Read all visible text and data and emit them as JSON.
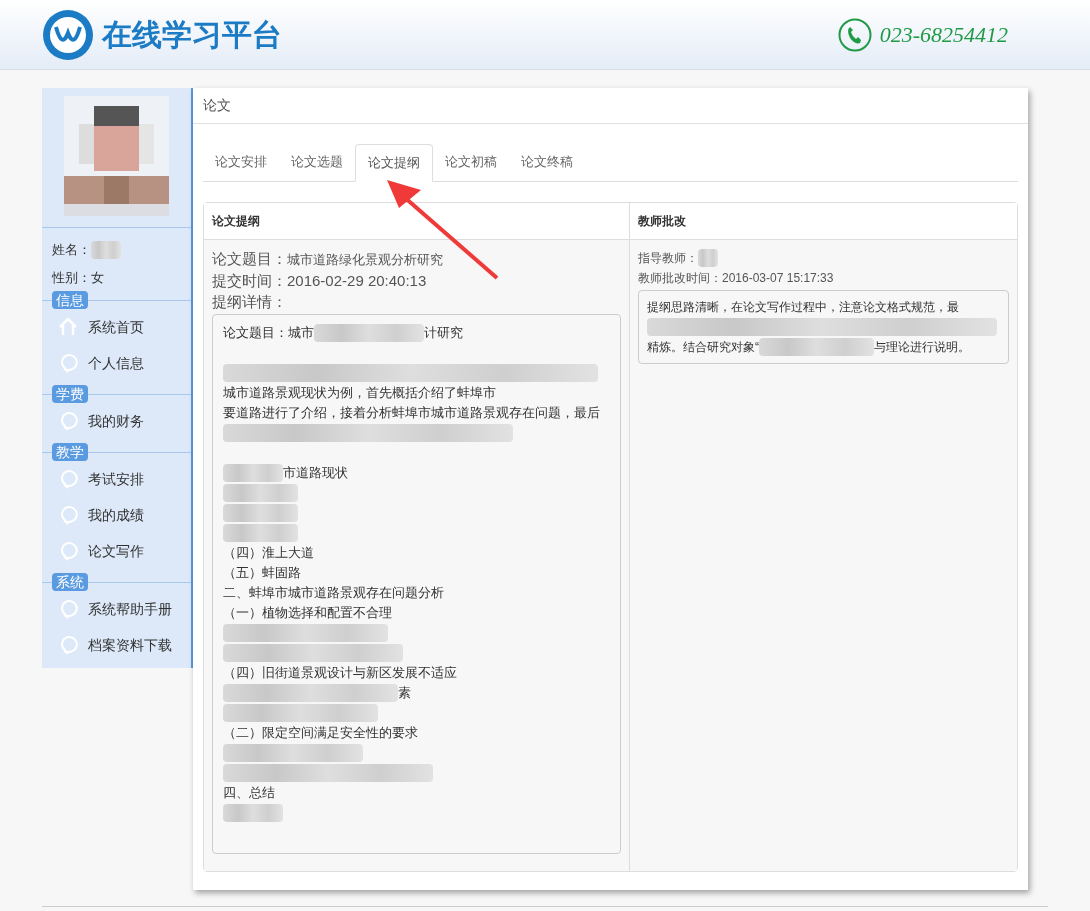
{
  "header": {
    "title": "在线学习平台",
    "phone": "023-68254412"
  },
  "profile": {
    "name_label": "姓名：",
    "gender_label": "性别：",
    "gender": "女"
  },
  "sidebar": [
    {
      "section": "信息",
      "items": [
        {
          "label": "系统首页",
          "kind": "home"
        },
        {
          "label": "个人信息",
          "kind": "bubble"
        }
      ]
    },
    {
      "section": "学费",
      "items": [
        {
          "label": "我的财务",
          "kind": "bubble"
        }
      ]
    },
    {
      "section": "教学",
      "items": [
        {
          "label": "考试安排",
          "kind": "bubble"
        },
        {
          "label": "我的成绩",
          "kind": "bubble"
        },
        {
          "label": "论文写作",
          "kind": "bubble"
        }
      ]
    },
    {
      "section": "系统",
      "items": [
        {
          "label": "系统帮助手册",
          "kind": "bubble"
        },
        {
          "label": "档案资料下载",
          "kind": "bubble"
        }
      ]
    }
  ],
  "panel": {
    "title": "论文",
    "tabs": [
      {
        "label": "论文安排",
        "selected": false
      },
      {
        "label": "论文选题",
        "selected": false
      },
      {
        "label": "论文提纲",
        "selected": true
      },
      {
        "label": "论文初稿",
        "selected": false
      },
      {
        "label": "论文终稿",
        "selected": false
      }
    ],
    "outline": {
      "heading": "论文提纲",
      "topic_label": "论文题目：",
      "topic": "城市道路绿化景观分析研究",
      "time_label": "提交时间：",
      "time": "2016-02-29 20:40:13",
      "details_label": "提纲详情：",
      "lines": [
        [
          {
            "kind": "text",
            "text": "论文题目：城市"
          },
          {
            "kind": "blur"
          },
          {
            "kind": "text",
            "text": "计研究"
          }
        ],
        [
          {
            "kind": "gap"
          }
        ],
        [
          {
            "kind": "blur"
          }
        ],
        [
          {
            "kind": "text",
            "text": "城市道路景观现状为例，首先概括介绍了蚌埠市"
          }
        ],
        [
          {
            "kind": "text",
            "text": "要道路进行了介绍，接着分析蚌埠市城市道路景观存在问题，最后"
          }
        ],
        [
          {
            "kind": "blur"
          }
        ],
        [
          {
            "kind": "gap"
          }
        ],
        [
          {
            "kind": "blur"
          },
          {
            "kind": "text",
            "text": "市道路现状"
          }
        ],
        [
          {
            "kind": "blur"
          }
        ],
        [
          {
            "kind": "blur"
          }
        ],
        [
          {
            "kind": "blur"
          }
        ],
        [
          {
            "kind": "text",
            "text": "（四）淮上大道"
          }
        ],
        [
          {
            "kind": "text",
            "text": "（五）蚌固路"
          }
        ],
        [
          {
            "kind": "text",
            "text": "二、蚌埠市城市道路景观存在问题分析"
          }
        ],
        [
          {
            "kind": "text",
            "text": "（一）植物选择和配置不合理"
          }
        ],
        [
          {
            "kind": "blur"
          }
        ],
        [
          {
            "kind": "blur"
          }
        ],
        [
          {
            "kind": "text",
            "text": "（四）旧街道景观设计与新区发展不适应"
          }
        ],
        [
          {
            "kind": "blur"
          },
          {
            "kind": "text",
            "text": "素"
          }
        ],
        [
          {
            "kind": "blur"
          }
        ],
        [
          {
            "kind": "text",
            "text": "（二）限定空间满足安全性的要求"
          }
        ],
        [
          {
            "kind": "blur"
          }
        ],
        [
          {
            "kind": "blur"
          }
        ],
        [
          {
            "kind": "text",
            "text": "四、总结"
          }
        ],
        [
          {
            "kind": "blur"
          }
        ]
      ]
    },
    "review": {
      "heading": "教师批改",
      "teacher_label": "指导教师：",
      "time_label": "教师批改时间：",
      "time": "2016-03-07 15:17:33",
      "lines": [
        [
          {
            "kind": "text",
            "text": "提纲思路清晰，在论文写作过程中，注意论文格式规范，最"
          }
        ],
        [
          {
            "kind": "blur"
          }
        ],
        [
          {
            "kind": "text",
            "text": "精炼。结合研究对象“"
          },
          {
            "kind": "blur"
          },
          {
            "kind": "text",
            "text": "与理论进行说明。"
          }
        ]
      ]
    }
  }
}
